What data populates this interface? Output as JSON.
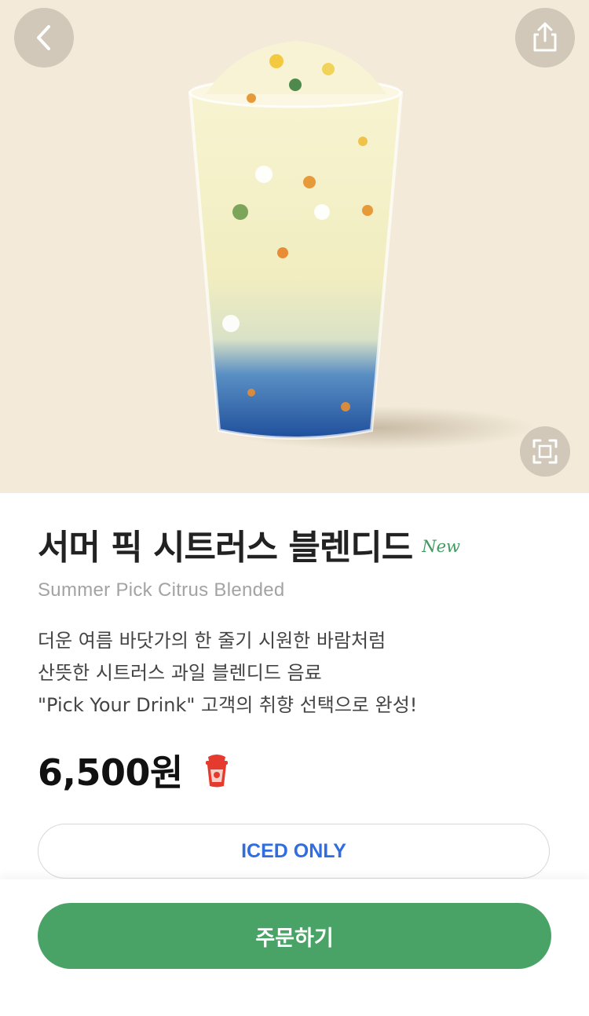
{
  "hero": {
    "back_icon": "chevron-left-icon",
    "share_icon": "share-icon",
    "zoom_icon": "fullscreen-icon"
  },
  "product": {
    "name_ko": "서머 픽 시트러스 블렌디드",
    "badge": "New",
    "name_en": "Summer Pick Citrus Blended",
    "description": [
      "더운 여름 바닷가의 한 줄기 시원한 바람처럼",
      "산뜻한 시트러스 과일 블렌디드 음료",
      "\"Pick Your Drink\" 고객의 취향 선택으로 완성!"
    ],
    "price": "6,500원",
    "price_icon": "cup-icon",
    "temperature_option": "ICED ONLY"
  },
  "order": {
    "label": "주문하기"
  },
  "colors": {
    "hero_bg": "#f3ead9",
    "accent_green": "#4aa366",
    "badge_green": "#3f9a5f",
    "iced_blue": "#2f6de1"
  }
}
